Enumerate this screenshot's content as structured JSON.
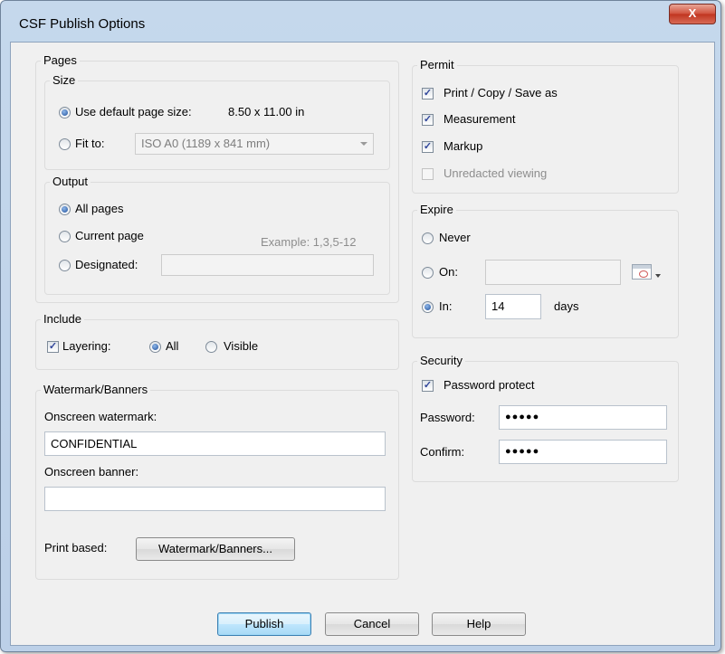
{
  "window": {
    "title": "CSF Publish Options",
    "close_glyph": "X"
  },
  "pages": {
    "label": "Pages",
    "size": {
      "label": "Size",
      "default_option": "Use default page size:",
      "default_value": "8.50 x 11.00 in",
      "fit_option": "Fit to:",
      "fit_value": "ISO A0 (1189 x 841 mm)"
    },
    "output": {
      "label": "Output",
      "all": "All pages",
      "current": "Current page",
      "example": "Example: 1,3,5-12",
      "designated": "Designated:",
      "designated_value": ""
    }
  },
  "include": {
    "label": "Include",
    "layering": "Layering:",
    "all": "All",
    "visible": "Visible"
  },
  "watermark": {
    "label": "Watermark/Banners",
    "onscreen_watermark_label": "Onscreen watermark:",
    "onscreen_watermark_value": "CONFIDENTIAL",
    "onscreen_banner_label": "Onscreen banner:",
    "onscreen_banner_value": "",
    "print_based_label": "Print based:",
    "print_based_button": "Watermark/Banners..."
  },
  "permit": {
    "label": "Permit",
    "print": "Print / Copy / Save as",
    "measurement": "Measurement",
    "markup": "Markup",
    "unredacted": "Unredacted viewing"
  },
  "expire": {
    "label": "Expire",
    "never": "Never",
    "on": "On:",
    "on_value": "",
    "in": "In:",
    "in_value": "14",
    "days": "days"
  },
  "security": {
    "label": "Security",
    "password_protect": "Password protect",
    "password_label": "Password:",
    "password_value": "●●●●●",
    "confirm_label": "Confirm:",
    "confirm_value": "●●●●●"
  },
  "buttons": {
    "publish": "Publish",
    "cancel": "Cancel",
    "help": "Help"
  },
  "colors": {
    "titlebar": "#c5d8ec",
    "close": "#c9432d",
    "dialog_bg": "#f0f0f0",
    "default_button": "#bee6fd"
  }
}
